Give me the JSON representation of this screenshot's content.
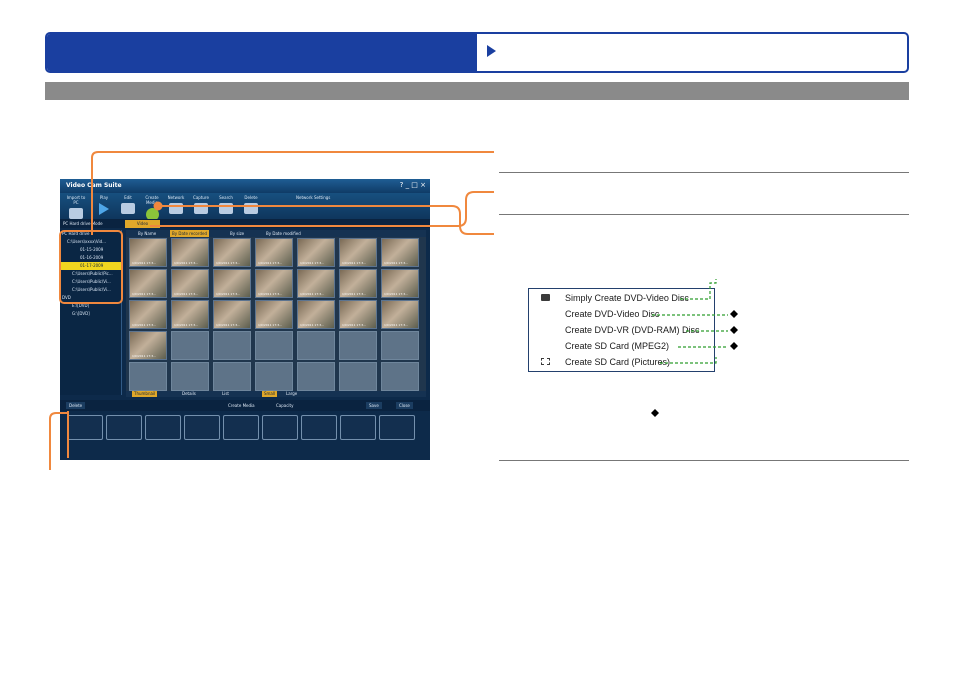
{
  "app": {
    "title": "Video Cam Suite",
    "window_controls": "?  _  □  ×",
    "toolbar": [
      {
        "label": "Import to PC",
        "icon": "import-icon"
      },
      {
        "label": "Play",
        "icon": "play-icon"
      },
      {
        "label": "Edit",
        "icon": "edit-icon"
      },
      {
        "label": "Create Media",
        "icon": "create-media-icon"
      },
      {
        "label": "Network",
        "icon": "network-icon"
      },
      {
        "label": "Capture",
        "icon": "capture-icon"
      },
      {
        "label": "Search",
        "icon": "search-icon"
      },
      {
        "label": "Delete",
        "icon": "delete-icon"
      }
    ],
    "network_settings_label": "Network Settings",
    "mode_label": "PC Hard drive Mode",
    "video_tab": "Video",
    "tree": [
      "PC Hard drive",
      "C:\\Users\\xxxx\\Vid...",
      "01-15-2009",
      "01-16-2009",
      "01-17-2009",
      "C:\\Users\\Public\\Pic...",
      "C:\\Users\\Public\\Vi...",
      "C:\\Users\\Public\\Vi...",
      "DVD",
      "E:\\[DVD]",
      "G:\\[DVD]"
    ],
    "sort_labels": [
      "By Name",
      "By Date recorded",
      "By size",
      "By Date modified"
    ],
    "thumb_caption": "1/0/2011 17:3...",
    "view_labels": [
      "Thumbnail",
      "Details",
      "List",
      "Small",
      "Large"
    ],
    "bottom": {
      "delete": "Delete",
      "create_media": "Create Media",
      "capacity": "Capacity",
      "save": "Save",
      "close": "Close"
    }
  },
  "menu": {
    "items": [
      "Simply Create DVD-Video Disc",
      "Create DVD-Video Disc",
      "Create DVD-VR (DVD-RAM) Disc",
      "Create SD Card (MPEG2)",
      "Create SD Card (Pictures)"
    ]
  },
  "colors": {
    "banner_blue": "#1a3fa0",
    "callout_orange": "#f0883e",
    "leader_green": "#2f9e2f",
    "selected_yellow": "#f1d61f"
  }
}
